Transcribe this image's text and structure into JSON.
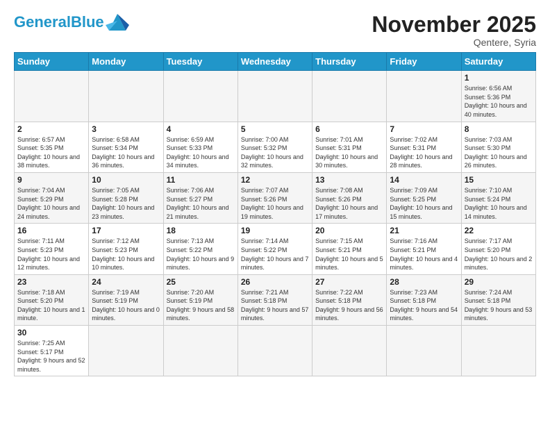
{
  "header": {
    "logo_general": "General",
    "logo_blue": "Blue",
    "month_title": "November 2025",
    "location": "Qentere, Syria"
  },
  "weekdays": [
    "Sunday",
    "Monday",
    "Tuesday",
    "Wednesday",
    "Thursday",
    "Friday",
    "Saturday"
  ],
  "days": {
    "1": {
      "sunrise": "6:56 AM",
      "sunset": "5:36 PM",
      "daylight": "10 hours and 40 minutes."
    },
    "2": {
      "sunrise": "6:57 AM",
      "sunset": "5:35 PM",
      "daylight": "10 hours and 38 minutes."
    },
    "3": {
      "sunrise": "6:58 AM",
      "sunset": "5:34 PM",
      "daylight": "10 hours and 36 minutes."
    },
    "4": {
      "sunrise": "6:59 AM",
      "sunset": "5:33 PM",
      "daylight": "10 hours and 34 minutes."
    },
    "5": {
      "sunrise": "7:00 AM",
      "sunset": "5:32 PM",
      "daylight": "10 hours and 32 minutes."
    },
    "6": {
      "sunrise": "7:01 AM",
      "sunset": "5:31 PM",
      "daylight": "10 hours and 30 minutes."
    },
    "7": {
      "sunrise": "7:02 AM",
      "sunset": "5:31 PM",
      "daylight": "10 hours and 28 minutes."
    },
    "8": {
      "sunrise": "7:03 AM",
      "sunset": "5:30 PM",
      "daylight": "10 hours and 26 minutes."
    },
    "9": {
      "sunrise": "7:04 AM",
      "sunset": "5:29 PM",
      "daylight": "10 hours and 24 minutes."
    },
    "10": {
      "sunrise": "7:05 AM",
      "sunset": "5:28 PM",
      "daylight": "10 hours and 23 minutes."
    },
    "11": {
      "sunrise": "7:06 AM",
      "sunset": "5:27 PM",
      "daylight": "10 hours and 21 minutes."
    },
    "12": {
      "sunrise": "7:07 AM",
      "sunset": "5:26 PM",
      "daylight": "10 hours and 19 minutes."
    },
    "13": {
      "sunrise": "7:08 AM",
      "sunset": "5:26 PM",
      "daylight": "10 hours and 17 minutes."
    },
    "14": {
      "sunrise": "7:09 AM",
      "sunset": "5:25 PM",
      "daylight": "10 hours and 15 minutes."
    },
    "15": {
      "sunrise": "7:10 AM",
      "sunset": "5:24 PM",
      "daylight": "10 hours and 14 minutes."
    },
    "16": {
      "sunrise": "7:11 AM",
      "sunset": "5:23 PM",
      "daylight": "10 hours and 12 minutes."
    },
    "17": {
      "sunrise": "7:12 AM",
      "sunset": "5:23 PM",
      "daylight": "10 hours and 10 minutes."
    },
    "18": {
      "sunrise": "7:13 AM",
      "sunset": "5:22 PM",
      "daylight": "10 hours and 9 minutes."
    },
    "19": {
      "sunrise": "7:14 AM",
      "sunset": "5:22 PM",
      "daylight": "10 hours and 7 minutes."
    },
    "20": {
      "sunrise": "7:15 AM",
      "sunset": "5:21 PM",
      "daylight": "10 hours and 5 minutes."
    },
    "21": {
      "sunrise": "7:16 AM",
      "sunset": "5:21 PM",
      "daylight": "10 hours and 4 minutes."
    },
    "22": {
      "sunrise": "7:17 AM",
      "sunset": "5:20 PM",
      "daylight": "10 hours and 2 minutes."
    },
    "23": {
      "sunrise": "7:18 AM",
      "sunset": "5:20 PM",
      "daylight": "10 hours and 1 minute."
    },
    "24": {
      "sunrise": "7:19 AM",
      "sunset": "5:19 PM",
      "daylight": "10 hours and 0 minutes."
    },
    "25": {
      "sunrise": "7:20 AM",
      "sunset": "5:19 PM",
      "daylight": "9 hours and 58 minutes."
    },
    "26": {
      "sunrise": "7:21 AM",
      "sunset": "5:18 PM",
      "daylight": "9 hours and 57 minutes."
    },
    "27": {
      "sunrise": "7:22 AM",
      "sunset": "5:18 PM",
      "daylight": "9 hours and 56 minutes."
    },
    "28": {
      "sunrise": "7:23 AM",
      "sunset": "5:18 PM",
      "daylight": "9 hours and 54 minutes."
    },
    "29": {
      "sunrise": "7:24 AM",
      "sunset": "5:18 PM",
      "daylight": "9 hours and 53 minutes."
    },
    "30": {
      "sunrise": "7:25 AM",
      "sunset": "5:17 PM",
      "daylight": "9 hours and 52 minutes."
    }
  }
}
